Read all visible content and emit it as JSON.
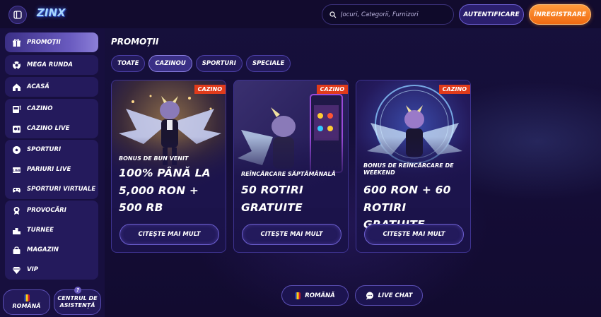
{
  "header": {
    "logo_text": "ZINX",
    "search_placeholder": "Jocuri, Categorii, Furnizori",
    "login_label": "AUTENTIFICARE",
    "register_label": "ÎNREGISTRARE"
  },
  "sidebar": {
    "items": [
      {
        "label": "PROMOȚII",
        "icon": "gift-icon"
      },
      {
        "label": "MEGA RUNDA",
        "icon": "ball-icon"
      },
      {
        "label": "ACASĂ",
        "icon": "home-icon"
      },
      {
        "label": "CAZINO",
        "icon": "slot-icon"
      },
      {
        "label": "CAZINO LIVE",
        "icon": "live-casino-icon"
      },
      {
        "label": "SPORTURI",
        "icon": "soccer-icon"
      },
      {
        "label": "PARIURI LIVE",
        "icon": "live-bet-icon"
      },
      {
        "label": "SPORTURI VIRTUALE",
        "icon": "gamepad-icon"
      },
      {
        "label": "PROVOCĂRI",
        "icon": "medal-icon"
      },
      {
        "label": "TURNEE",
        "icon": "podium-icon"
      },
      {
        "label": "MAGAZIN",
        "icon": "shop-icon"
      },
      {
        "label": "VIP",
        "icon": "diamond-icon"
      }
    ],
    "language_label": "ROMÂNĂ",
    "help_label_line1": "CENTRUL DE",
    "help_label_line2": "ASISTENȚĂ",
    "help_badge": "?"
  },
  "main": {
    "title": "PROMOȚII",
    "tabs": [
      "TOATE",
      "CAZINOU",
      "SPORTURI",
      "SPECIALE"
    ],
    "active_tab": "CAZINOU",
    "cards": [
      {
        "badge": "CAZINO",
        "subtitle": "BONUS DE BUN VENIT",
        "lines": [
          "100% PÂNĂ LA",
          "5,000 RON +",
          "500 RB"
        ],
        "button": "CITEȘTE MAI MULT"
      },
      {
        "badge": "CAZINO",
        "subtitle": "REÎNCĂRCARE SĂPTĂMÂNALĂ",
        "lines": [
          "50 ROTIRI",
          "GRATUITE"
        ],
        "button": "CITEȘTE MAI MULT"
      },
      {
        "badge": "CAZINO",
        "subtitle": "BONUS DE REÎNCĂRCARE DE WEEKEND",
        "lines": [
          "600 RON + 60",
          "ROTIRI GRATUITE"
        ],
        "button": "CITEȘTE MAI MULT"
      }
    ]
  },
  "footer": {
    "language_label": "ROMÂNĂ",
    "chat_label": "LIVE CHAT"
  },
  "colors": {
    "background": "#140d36",
    "accent_orange": "#f07a1e",
    "badge_red": "#e03b1b",
    "panel": "#241a5c"
  }
}
